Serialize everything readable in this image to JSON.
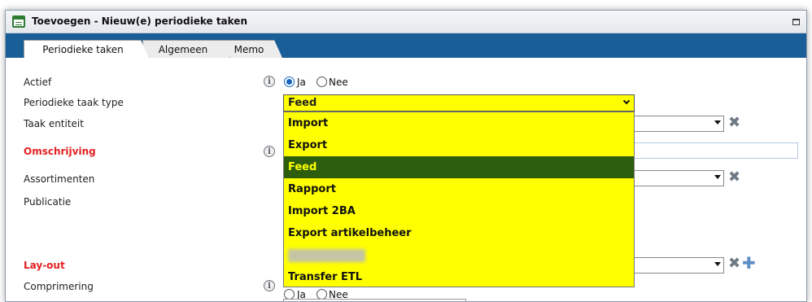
{
  "window": {
    "title": "Toevoegen - Nieuw(e) periodieke taken"
  },
  "tabs": [
    {
      "label": "Periodieke taken",
      "active": true
    },
    {
      "label": "Algemeen",
      "active": false
    },
    {
      "label": "Memo",
      "active": false
    }
  ],
  "form": {
    "actief_label": "Actief",
    "actief_ja": "Ja",
    "actief_nee": "Nee",
    "actief_value": "Ja",
    "type_label": "Periodieke taak type",
    "taak_entiteit_label": "Taak entiteit",
    "omschrijving_label": "Omschrijving",
    "assortimenten_label": "Assortimenten",
    "publicatie_label": "Publicatie",
    "layout_label": "Lay-out",
    "comprimering_label": "Comprimering",
    "comprimering_ja": "Ja",
    "comprimering_nee": "Nee",
    "info_glyph": "i",
    "remove_glyph": "✖",
    "add_glyph": "✚"
  },
  "dropdown": {
    "selected": "Feed",
    "options": [
      "Import",
      "Export",
      "Feed",
      "Rapport",
      "Import 2BA",
      "Export artikelbeheer",
      "",
      "Transfer ETL"
    ],
    "highlight_color": "#ffff00",
    "selected_bg": "#2d5e0e"
  },
  "colors": {
    "tab_bar": "#1a5e97",
    "required_label": "#e32020"
  }
}
